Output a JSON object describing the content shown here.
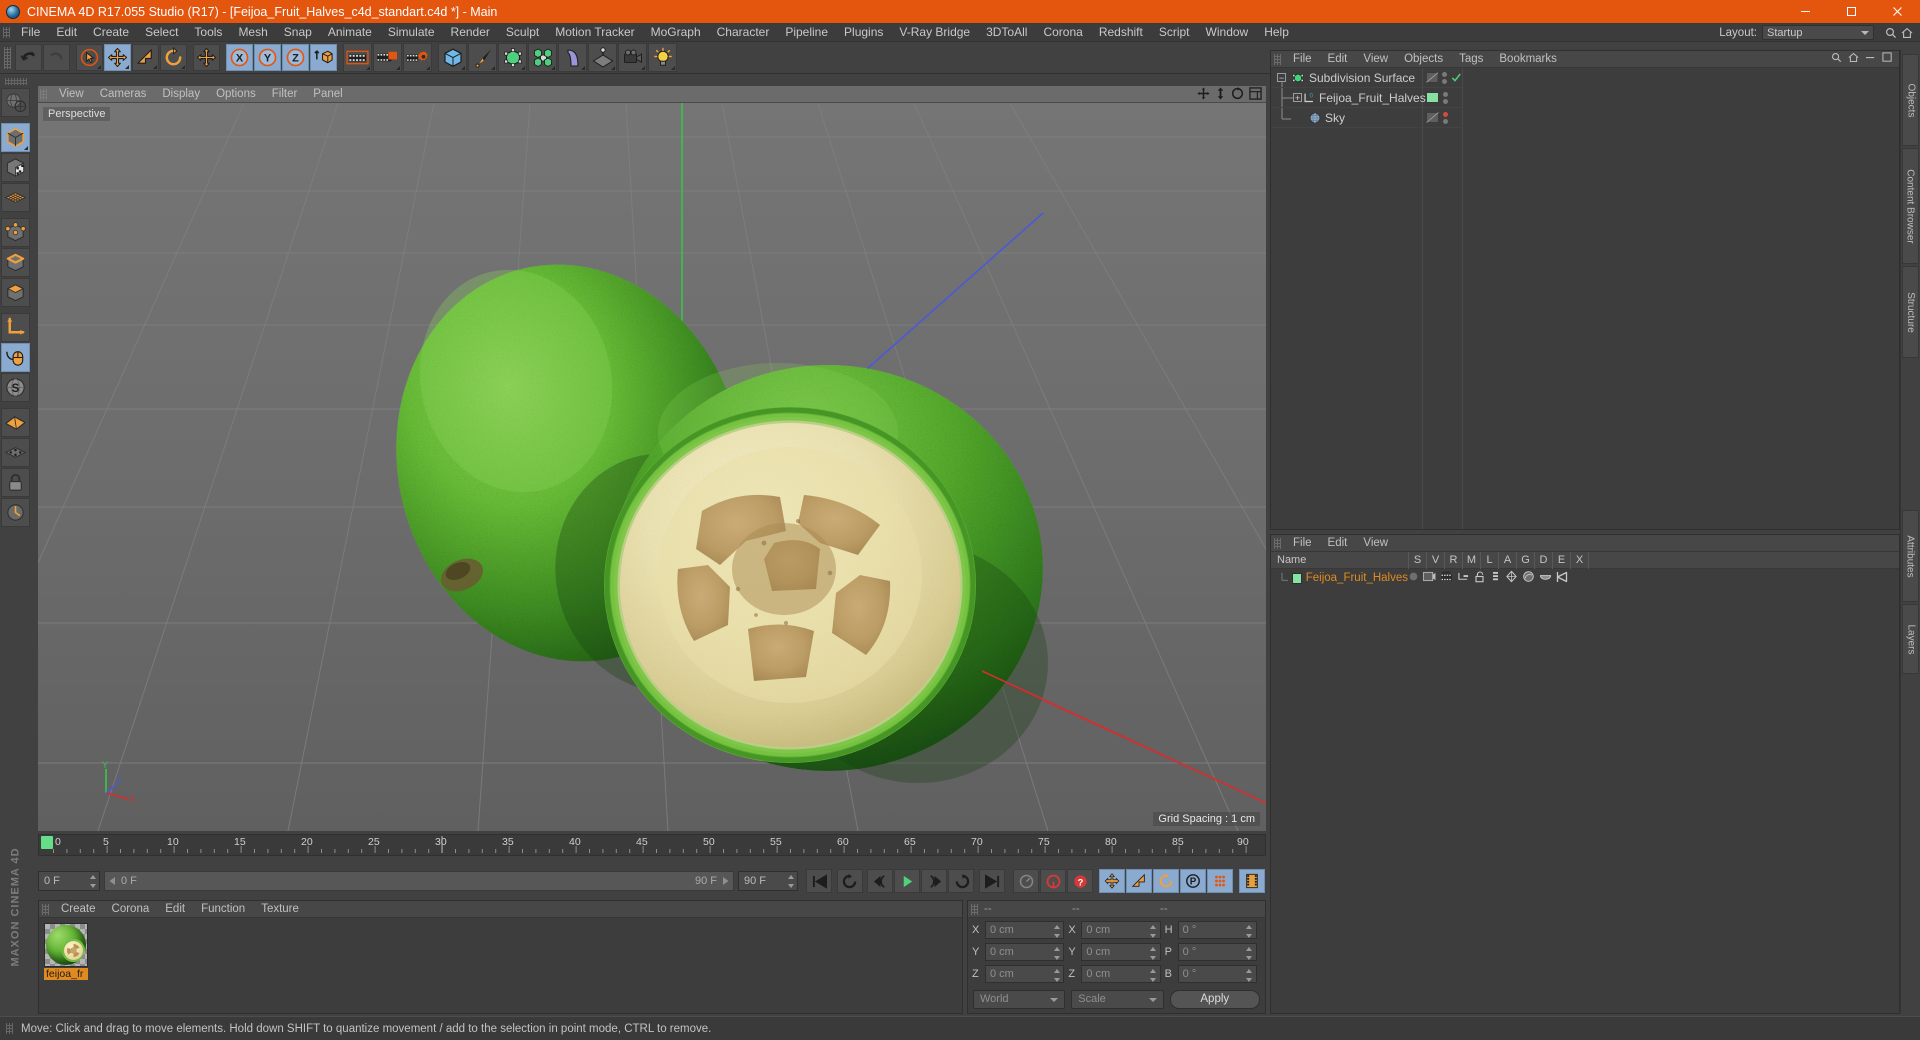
{
  "window": {
    "title": "CINEMA 4D R17.055 Studio (R17) - [Feijoa_Fruit_Halves_c4d_standart.c4d *] - Main",
    "minimize": "—",
    "maximize": "❐",
    "close": "✕"
  },
  "menubar": {
    "items": [
      "File",
      "Edit",
      "Create",
      "Select",
      "Tools",
      "Mesh",
      "Snap",
      "Animate",
      "Simulate",
      "Render",
      "Sculpt",
      "Motion Tracker",
      "MoGraph",
      "Character",
      "Pipeline",
      "Plugins",
      "V-Ray Bridge",
      "3DToAll",
      "Corona",
      "Redshift",
      "Script",
      "Window",
      "Help"
    ],
    "layout_label": "Layout:",
    "layout_value": "Startup"
  },
  "toolbar": {
    "groups": [
      {
        "name": "undo-redo",
        "buttons": [
          {
            "name": "undo-button",
            "icon": "undo-icon",
            "active": false
          },
          {
            "name": "redo-button",
            "icon": "redo-icon",
            "active": false
          }
        ]
      },
      {
        "name": "transform-tools",
        "buttons": [
          {
            "name": "live-selection-tool",
            "icon": "cursor-select-icon",
            "active": false
          },
          {
            "name": "move-tool",
            "icon": "move-arrows-icon",
            "active": true
          },
          {
            "name": "scale-tool",
            "icon": "scale-icon",
            "active": false
          },
          {
            "name": "rotate-tool",
            "icon": "rotate-icon",
            "active": false
          }
        ]
      },
      {
        "name": "move-mode",
        "buttons": [
          {
            "name": "move-mode-button",
            "icon": "move-arrows-icon",
            "active": false
          }
        ]
      },
      {
        "name": "axis-locks",
        "buttons": [
          {
            "name": "lock-x-axis",
            "icon": "axis-x-icon",
            "active": true
          },
          {
            "name": "lock-y-axis",
            "icon": "axis-y-icon",
            "active": true
          },
          {
            "name": "lock-z-axis",
            "icon": "axis-z-icon",
            "active": true
          },
          {
            "name": "world-object-coordinates",
            "icon": "world-coord-cube-icon",
            "active": false
          }
        ]
      },
      {
        "name": "render-group",
        "buttons": [
          {
            "name": "render-view-button",
            "icon": "render-view-icon",
            "active": false
          },
          {
            "name": "render-region-button",
            "icon": "render-region-icon",
            "active": false
          },
          {
            "name": "render-settings-button",
            "icon": "render-settings-icon",
            "active": false
          }
        ]
      },
      {
        "name": "create-group",
        "buttons": [
          {
            "name": "add-cube-button",
            "icon": "cube-icon",
            "active": false
          },
          {
            "name": "add-spline-button",
            "icon": "pen-spline-icon",
            "active": false
          },
          {
            "name": "add-nurbs-button",
            "icon": "subdivision-surface-icon",
            "active": false
          },
          {
            "name": "add-array-button",
            "icon": "array-icon",
            "active": false
          },
          {
            "name": "add-bend-button",
            "icon": "bend-deformer-icon",
            "active": false
          },
          {
            "name": "add-floor-button",
            "icon": "floor-scene-icon",
            "active": false
          },
          {
            "name": "add-camera-button",
            "icon": "camera-icon",
            "active": false
          },
          {
            "name": "add-light-button",
            "icon": "light-bulb-icon",
            "active": false
          }
        ]
      }
    ]
  },
  "left_tools": [
    {
      "name": "undo-view-button",
      "icon": "globe-view-icon",
      "active": false
    },
    {
      "name": "model-mode-button",
      "icon": "model-cube-icon",
      "active": true
    },
    {
      "name": "texture-mode-button",
      "icon": "texture-cube-icon",
      "active": false
    },
    {
      "name": "uv-mesh-button",
      "icon": "uv-grid-icon",
      "active": false
    },
    {
      "name": "points-mode-button",
      "icon": "points-cube-icon",
      "active": false
    },
    {
      "name": "edges-mode-button",
      "icon": "edges-cube-icon",
      "active": false
    },
    {
      "name": "polygons-mode-button",
      "icon": "polygons-cube-icon",
      "active": false
    },
    {
      "name": "axis-mode-button",
      "icon": "axis-modify-icon",
      "active": false
    },
    {
      "name": "viewport-solo-button",
      "icon": "mouse-icon",
      "active": true
    },
    {
      "name": "enable-axis-button",
      "icon": "snap-s-icon",
      "active": false
    },
    {
      "name": "workplane-button",
      "icon": "workplane-icon",
      "active": false
    },
    {
      "name": "snap-settings-button",
      "icon": "snap-grid-icon",
      "active": false
    },
    {
      "name": "lock-workplane-button",
      "icon": "padlock-icon",
      "active": false
    },
    {
      "name": "quantize-button",
      "icon": "quantize-icon",
      "active": false
    }
  ],
  "viewport": {
    "menu": [
      "View",
      "Cameras",
      "Display",
      "Options",
      "Filter",
      "Panel"
    ],
    "label": "Perspective",
    "grid_spacing": "Grid Spacing : 1 cm",
    "axis_labels": {
      "y": "Y",
      "x": "X",
      "z": "Z"
    },
    "tool_icons": [
      "pan-view-icon",
      "dolly-view-icon",
      "rotate-view-icon",
      "maximize-view-icon"
    ]
  },
  "timeline": {
    "playhead_frame": "0",
    "ticks": [
      "0",
      "5",
      "10",
      "15",
      "20",
      "25",
      "30",
      "35",
      "40",
      "45",
      "50",
      "55",
      "60",
      "65",
      "70",
      "75",
      "80",
      "85",
      "90"
    ],
    "current_frame_right": "0 F"
  },
  "transport": {
    "current_frame": "0 F",
    "range_start": "0 F",
    "range_end": "90 F",
    "max_frame": "90 F",
    "buttons": [
      {
        "name": "go-to-start-button",
        "icon": "skip-start-icon",
        "active": false
      },
      {
        "name": "play-reverse-button",
        "icon": "loop-reverse-icon",
        "active": false
      },
      {
        "name": "previous-frame-button",
        "icon": "step-back-icon",
        "active": false
      },
      {
        "name": "play-button",
        "icon": "play-icon",
        "active": false
      },
      {
        "name": "next-frame-button",
        "icon": "step-forward-icon",
        "active": false
      },
      {
        "name": "play-forward-loop-button",
        "icon": "loop-forward-icon",
        "active": false
      },
      {
        "name": "go-to-end-button",
        "icon": "skip-end-icon",
        "active": false
      },
      {
        "name": "record-active-objects-button",
        "icon": "keyframe-gauge-icon",
        "active": false
      },
      {
        "name": "autokeying-button",
        "icon": "autokey-icon",
        "active": false
      },
      {
        "name": "keyframe-selection-button",
        "icon": "keyframe-help-icon",
        "active": false
      },
      {
        "name": "position-key-button",
        "icon": "move-arrows-icon",
        "active": true
      },
      {
        "name": "scale-key-button",
        "icon": "scale-icon",
        "active": true
      },
      {
        "name": "rotation-key-button",
        "icon": "rotate-icon",
        "active": true
      },
      {
        "name": "parameter-key-button",
        "icon": "param-p-icon",
        "active": true
      },
      {
        "name": "point-level-animation-button",
        "icon": "pla-dots-icon",
        "active": true
      },
      {
        "name": "timeline-toggle-button",
        "icon": "filmstrip-icon",
        "active": true
      }
    ]
  },
  "material_manager": {
    "menu": [
      "Create",
      "Corona",
      "Edit",
      "Function",
      "Texture"
    ],
    "materials": [
      {
        "name": "feijoa_fr",
        "selected": true
      }
    ]
  },
  "coordinates": {
    "headers": [
      "--",
      "--",
      "--"
    ],
    "rows": [
      {
        "pos_label": "X",
        "pos_value": "0 cm",
        "size_label": "X",
        "size_value": "0 cm",
        "rot_label": "H",
        "rot_value": "0 °"
      },
      {
        "pos_label": "Y",
        "pos_value": "0 cm",
        "size_label": "Y",
        "size_value": "0 cm",
        "rot_label": "P",
        "rot_value": "0 °"
      },
      {
        "pos_label": "Z",
        "pos_value": "0 cm",
        "size_label": "Z",
        "size_value": "0 cm",
        "rot_label": "B",
        "rot_value": "0 °"
      }
    ],
    "coord_system": "World",
    "mode": "Scale",
    "apply_label": "Apply"
  },
  "object_manager": {
    "menu": [
      "File",
      "Edit",
      "View",
      "Objects",
      "Tags",
      "Bookmarks"
    ],
    "rows": [
      {
        "name": "Subdivision Surface",
        "icon": "subdivision-surface-icon",
        "depth": 0,
        "expander": "−",
        "selected": false,
        "visibility": "half",
        "dots": "gray",
        "check": true,
        "tag_color": null
      },
      {
        "name": "Feijoa_Fruit_Halves",
        "icon": "polygon-object-icon",
        "depth": 1,
        "expander": "+",
        "selected": false,
        "visibility": "none",
        "dots": "gray",
        "check": false,
        "tag_color": "#86e2a0"
      },
      {
        "name": "Sky",
        "icon": "sky-sphere-icon",
        "depth": 1,
        "expander": "",
        "selected": false,
        "visibility": "half",
        "dots": "red",
        "check": false,
        "tag_color": null
      }
    ]
  },
  "attribute_panel": {
    "menu": [
      "File",
      "Edit",
      "View"
    ],
    "columns": [
      "Name",
      "S",
      "V",
      "R",
      "M",
      "L",
      "A",
      "G",
      "D",
      "E",
      "X"
    ],
    "rows": [
      {
        "name": "Feijoa_Fruit_Halves",
        "selected": true,
        "swatch": "#86e2a0"
      }
    ]
  },
  "dock_tabs": [
    "Objects",
    "Content Browser",
    "Structure",
    "Attributes",
    "Layers"
  ],
  "statusbar": {
    "text": "Move: Click and drag to move elements. Hold down SHIFT to quantize movement / add to the selection in point mode, CTRL to remove."
  },
  "brand": "MAXON CINEMA 4D",
  "colors": {
    "accent_orange": "#e4550e",
    "selected_blue": "#8aabcf",
    "text_orange": "#e08a20",
    "green_swatch": "#86e2a0"
  }
}
